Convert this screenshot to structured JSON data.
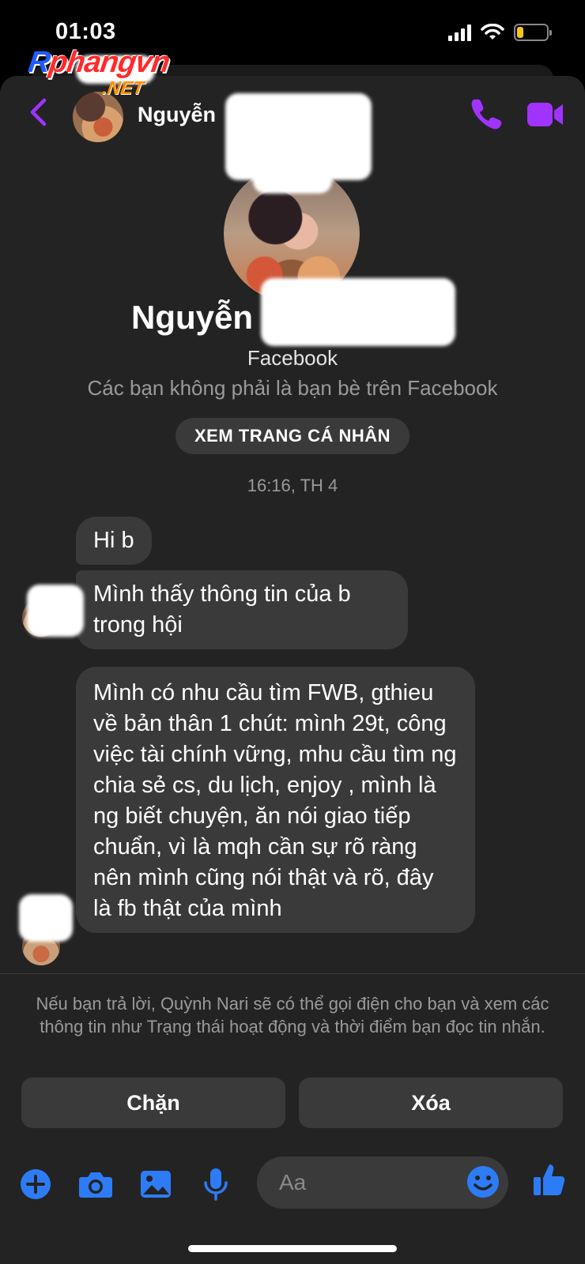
{
  "status": {
    "time": "01:03"
  },
  "watermark": {
    "main": "Rphangvn",
    "sub": ".NET"
  },
  "header": {
    "name": "Nguyễn"
  },
  "profile": {
    "name": "Nguyễn",
    "subtitle": "Facebook",
    "relationship_note": "Các bạn không phải là bạn bè trên Facebook",
    "view_profile_label": "XEM TRANG CÁ NHÂN"
  },
  "conversation": {
    "timestamp": "16:16, TH 4",
    "messages": [
      "Hi b",
      "Mình thấy thông tin của b trong hội",
      "Mình có nhu cầu tìm FWB, gthieu về bản thân 1 chút: mình 29t, công việc tài chính vững, mhu cầu tìm ng chia sẻ cs, du lịch, enjoy , mình là ng biết chuyện, ăn nói giao tiếp chuẩn, vì là mqh cần sự rõ ràng nên mình cũng nói thật và rõ, đây là fb thật của mình"
    ]
  },
  "request_notice": "Nếu bạn trả lời, Quỳnh Nari sẽ có thể gọi điện cho bạn và xem các thông tin như Trạng thái hoạt động và thời điểm bạn đọc tin nhắn.",
  "actions": {
    "block_label": "Chặn",
    "delete_label": "Xóa"
  },
  "composer": {
    "placeholder": "Aa"
  },
  "colors": {
    "accent": "#a033ff",
    "composer_blue": "#2d7cf6",
    "battery": "#f5c518",
    "background": "#232323",
    "bubble": "#3a3a3a"
  }
}
